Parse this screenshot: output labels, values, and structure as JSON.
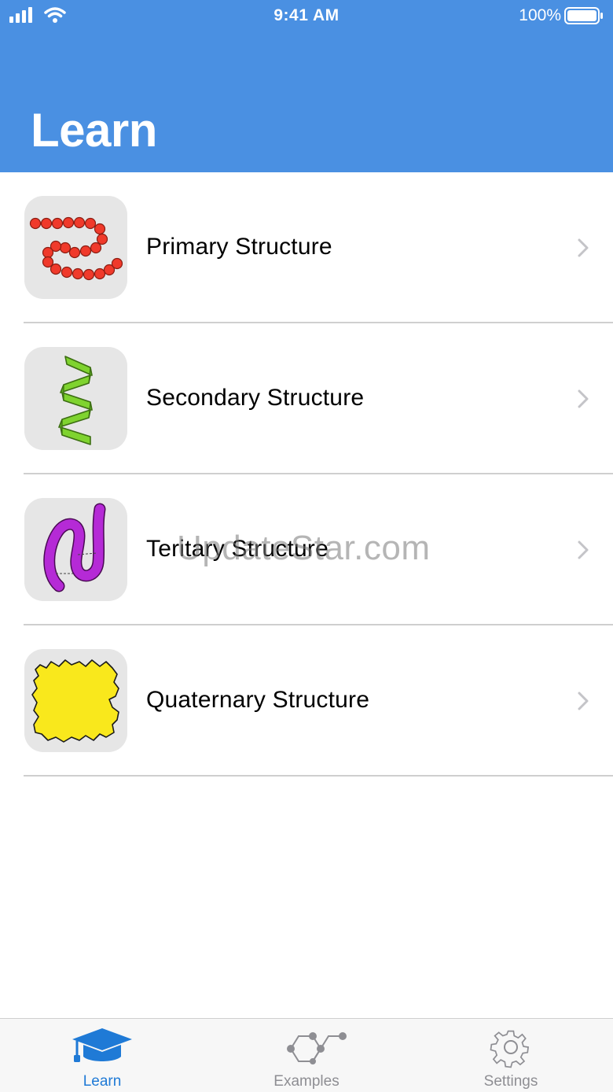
{
  "status_bar": {
    "time": "9:41 AM",
    "battery": "100%",
    "icons": [
      "signal-icon",
      "wifi-icon",
      "battery-icon"
    ]
  },
  "header": {
    "title": "Learn",
    "color": "#4a90e2"
  },
  "list": {
    "items": [
      {
        "label": "Primary Structure",
        "icon": "primary-structure-icon"
      },
      {
        "label": "Secondary Structure",
        "icon": "secondary-structure-icon"
      },
      {
        "label": "Teritary Structure",
        "icon": "tertiary-structure-icon"
      },
      {
        "label": "Quaternary Structure",
        "icon": "quaternary-structure-icon"
      }
    ]
  },
  "watermark": "UpdateStar.com",
  "tabbar": {
    "tabs": [
      {
        "label": "Learn",
        "icon": "graduation-cap-icon",
        "selected": true
      },
      {
        "label": "Examples",
        "icon": "molecule-icon",
        "selected": false
      },
      {
        "label": "Settings",
        "icon": "gear-icon",
        "selected": false
      }
    ],
    "active_color": "#1f7ad6",
    "inactive_color": "#8e8e93"
  }
}
